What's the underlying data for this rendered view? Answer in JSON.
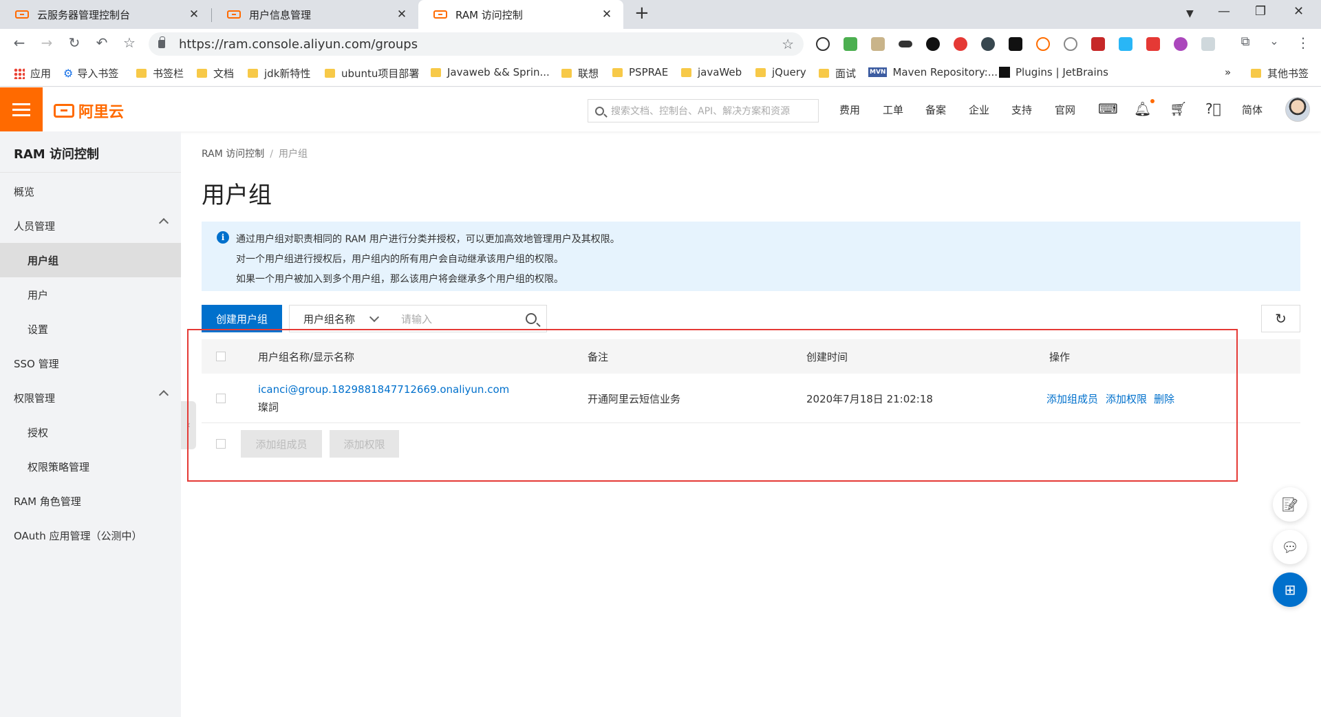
{
  "browser": {
    "tabs": [
      {
        "title": "云服务器管理控制台",
        "close": "✕"
      },
      {
        "title": "用户信息管理",
        "close": "✕"
      },
      {
        "title": "RAM 访问控制",
        "close": "✕"
      }
    ],
    "new_tab": "+",
    "url": "https://ram.console.aliyun.com/groups",
    "bookmarks": [
      {
        "label": "应用",
        "icon": "apps-icon"
      },
      {
        "label": "导入书签",
        "icon": "gear-icon"
      },
      {
        "label": "书签栏",
        "icon": "folder-icon"
      },
      {
        "label": "文档",
        "icon": "folder-icon"
      },
      {
        "label": "jdk新特性",
        "icon": "folder-icon"
      },
      {
        "label": "ubuntu项目部署",
        "icon": "folder-icon"
      },
      {
        "label": "Javaweb && Sprin...",
        "icon": "folder-icon"
      },
      {
        "label": "联想",
        "icon": "folder-icon"
      },
      {
        "label": "PSPRAE",
        "icon": "folder-icon"
      },
      {
        "label": "javaWeb",
        "icon": "folder-icon"
      },
      {
        "label": "jQuery",
        "icon": "folder-icon"
      },
      {
        "label": "面试",
        "icon": "folder-icon"
      },
      {
        "label": "Maven Repository:...",
        "icon": "maven-icon"
      },
      {
        "label": "Plugins | JetBrains",
        "icon": "jetbrains-icon"
      }
    ],
    "bookmarks_more": "»",
    "other_bookmarks": "其他书签"
  },
  "header": {
    "brand": "阿里云",
    "search_placeholder": "搜索文档、控制台、API、解决方案和资源",
    "nav": [
      "费用",
      "工单",
      "备案",
      "企业",
      "支持",
      "官网"
    ],
    "lang": "简体"
  },
  "sidebar": {
    "title": "RAM 访问控制",
    "items": [
      {
        "label": "概览"
      },
      {
        "label": "人员管理"
      },
      {
        "label": "用户组"
      },
      {
        "label": "用户"
      },
      {
        "label": "设置"
      },
      {
        "label": "SSO 管理"
      },
      {
        "label": "权限管理"
      },
      {
        "label": "授权"
      },
      {
        "label": "权限策略管理"
      },
      {
        "label": "RAM 角色管理"
      },
      {
        "label": "OAuth 应用管理（公测中）"
      }
    ]
  },
  "main": {
    "breadcrumb": {
      "root": "RAM 访问控制",
      "sep": "/",
      "current": "用户组"
    },
    "title": "用户组",
    "notice": [
      "通过用户组对职责相同的 RAM 用户进行分类并授权，可以更加高效地管理用户及其权限。",
      "对一个用户组进行授权后，用户组内的所有用户会自动继承该用户组的权限。",
      "如果一个用户被加入到多个用户组，那么该用户将会继承多个用户组的权限。"
    ],
    "create_button": "创建用户组",
    "filter_select": "用户组名称",
    "filter_placeholder": "请输入",
    "table": {
      "columns": [
        "用户组名称/显示名称",
        "备注",
        "创建时间",
        "操作"
      ],
      "rows": [
        {
          "name": "icanci@group.1829881847712669.onaliyun.com",
          "display_name": "璨詞",
          "remark": "开通阿里云短信业务",
          "created": "2020年7月18日 21:02:18",
          "actions": [
            "添加组成员",
            "添加权限",
            "删除"
          ]
        }
      ],
      "bulk_actions": [
        "添加组成员",
        "添加权限"
      ]
    }
  },
  "colors": {
    "brand": "#ff6a00",
    "primary": "#0070cc",
    "highlight": "#e53935"
  }
}
